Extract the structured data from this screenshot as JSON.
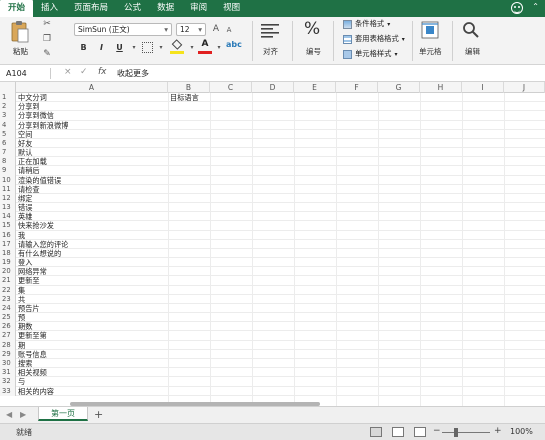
{
  "ribbon_tabs": [
    "开始",
    "插入",
    "页面布局",
    "公式",
    "数据",
    "审阅",
    "视图"
  ],
  "ribbon": {
    "paste_label": "粘贴",
    "font_name": "SimSun (正文)",
    "font_size": "12",
    "bold": "B",
    "italic": "I",
    "underline": "U",
    "align_label": "对齐",
    "number_label": "编号",
    "conditional_format": "条件格式",
    "table_format": "套用表格格式",
    "cell_styles": "单元格样式",
    "cells_label": "单元格",
    "edit_label": "编辑",
    "percent_symbol": "%",
    "font_color_letter": "A",
    "highlight_color": "#f5e31c",
    "font_color": "#e02020",
    "accent": "#1f7145"
  },
  "formula_bar": {
    "name_box": "A104",
    "cancel_symbol": "×",
    "confirm_symbol": "✓",
    "fx_symbol": "fx",
    "content": "收起更多"
  },
  "columns": [
    "A",
    "B",
    "C",
    "D",
    "E",
    "F",
    "G",
    "H",
    "I",
    "J"
  ],
  "rows": [
    {
      "n": "1",
      "a": "中文分词",
      "b": "目标语言"
    },
    {
      "n": "2",
      "a": "分享到",
      "b": ""
    },
    {
      "n": "3",
      "a": "分享到微信",
      "b": ""
    },
    {
      "n": "4",
      "a": "分享到新浪微博",
      "b": ""
    },
    {
      "n": "5",
      "a": "空间",
      "b": ""
    },
    {
      "n": "6",
      "a": "好友",
      "b": ""
    },
    {
      "n": "7",
      "a": "默认",
      "b": ""
    },
    {
      "n": "8",
      "a": "正在加载",
      "b": ""
    },
    {
      "n": "9",
      "a": "请稍后",
      "b": ""
    },
    {
      "n": "10",
      "a": "渲染的值错误",
      "b": ""
    },
    {
      "n": "11",
      "a": "请检查",
      "b": ""
    },
    {
      "n": "12",
      "a": "绑定",
      "b": ""
    },
    {
      "n": "13",
      "a": "错误",
      "b": ""
    },
    {
      "n": "14",
      "a": "英雄",
      "b": ""
    },
    {
      "n": "15",
      "a": "快来抢沙发",
      "b": ""
    },
    {
      "n": "16",
      "a": "我",
      "b": ""
    },
    {
      "n": "17",
      "a": "请输入您的评论",
      "b": ""
    },
    {
      "n": "18",
      "a": "有什么想说的",
      "b": ""
    },
    {
      "n": "19",
      "a": "登入",
      "b": ""
    },
    {
      "n": "20",
      "a": "网络异常",
      "b": ""
    },
    {
      "n": "21",
      "a": "更新至",
      "b": ""
    },
    {
      "n": "22",
      "a": "集",
      "b": ""
    },
    {
      "n": "23",
      "a": "共",
      "b": ""
    },
    {
      "n": "24",
      "a": "预告片",
      "b": ""
    },
    {
      "n": "25",
      "a": "预",
      "b": ""
    },
    {
      "n": "26",
      "a": "期数",
      "b": ""
    },
    {
      "n": "27",
      "a": "更新至第",
      "b": ""
    },
    {
      "n": "28",
      "a": "期",
      "b": ""
    },
    {
      "n": "29",
      "a": "账号信息",
      "b": ""
    },
    {
      "n": "30",
      "a": "搜索",
      "b": ""
    },
    {
      "n": "31",
      "a": "相关视频",
      "b": ""
    },
    {
      "n": "32",
      "a": "与",
      "b": ""
    },
    {
      "n": "33",
      "a": "相关的内容",
      "b": ""
    }
  ],
  "sheet": {
    "nav_prev": "◀",
    "nav_next": "▶",
    "tab_name": "第一页",
    "add_symbol": "+"
  },
  "status": {
    "ready": "就绪",
    "zoom_minus": "−",
    "zoom_plus": "+",
    "zoom_level": 100,
    "zoom": "100%"
  }
}
